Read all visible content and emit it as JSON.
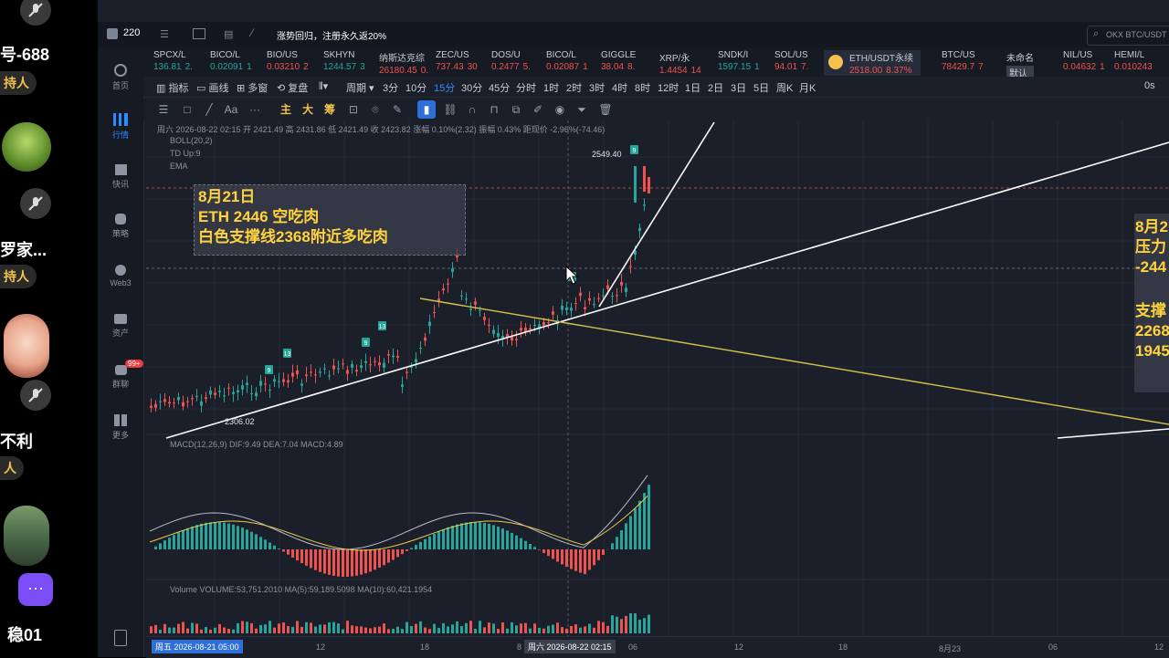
{
  "stream": {
    "names": [
      "号-688",
      "罗家...",
      "不利",
      "稳01"
    ],
    "badges": [
      "持人",
      "持人",
      "人"
    ]
  },
  "nav": {
    "items": [
      "首页",
      "行情",
      "快讯",
      "策略",
      "Web3",
      "资产",
      "群聊",
      "更多"
    ],
    "chat_badge": "99+"
  },
  "topbar": {
    "account": "220",
    "promo": "涨势回归，注册永久返20%",
    "search_placeholder": "OKX BTC/USDT"
  },
  "tickers": [
    {
      "name": "SPCX/L",
      "price": "136.81",
      "chg": "2.",
      "dir": "up"
    },
    {
      "name": "BICO/L",
      "price": "0.02091",
      "chg": "1",
      "dir": "up"
    },
    {
      "name": "BIO/US",
      "price": "0.03210",
      "chg": "2",
      "dir": "dn"
    },
    {
      "name": "SKHYN",
      "price": "1244.57",
      "chg": "3",
      "dir": "up"
    },
    {
      "name": "纳斯达克综",
      "price": "26180.45",
      "chg": "0.",
      "dir": "dn"
    },
    {
      "name": "ZEC/US",
      "price": "737.43",
      "chg": "30",
      "dir": "dn"
    },
    {
      "name": "DOS/U",
      "price": "0.2477",
      "chg": "5.",
      "dir": "dn"
    },
    {
      "name": "BICO/L",
      "price": "0.02087",
      "chg": "1",
      "dir": "dn"
    },
    {
      "name": "GIGGLE",
      "price": "38.04",
      "chg": "8.",
      "dir": "dn"
    },
    {
      "name": "XRP/永",
      "price": "1.4454",
      "chg": "14",
      "dir": "dn"
    },
    {
      "name": "SNDK/I",
      "price": "1597.15",
      "chg": "1",
      "dir": "up"
    },
    {
      "name": "SOL/US",
      "price": "94.01",
      "chg": "7.",
      "dir": "dn"
    },
    {
      "name": "ETH/USDT永续",
      "price": "2518.00",
      "chg": "8.37%",
      "dir": "dn"
    },
    {
      "name": "BTC/US",
      "price": "78429.7",
      "chg": "7",
      "dir": "dn"
    },
    {
      "name": "未命名",
      "price": "默认",
      "chg": "",
      "dir": "none"
    },
    {
      "name": "NIL/US",
      "price": "0.04632",
      "chg": "1",
      "dir": "dn"
    },
    {
      "name": "HEMI/L",
      "price": "0.010243",
      "chg": "",
      "dir": "dn"
    }
  ],
  "timeframes": {
    "left": [
      "指标",
      "画线",
      "多窗",
      "复盘"
    ],
    "period": "周期",
    "items": [
      "3分",
      "10分",
      "15分",
      "30分",
      "45分",
      "分时",
      "1时",
      "2时",
      "3时",
      "4时",
      "8时",
      "12时",
      "1日",
      "2日",
      "3日",
      "5日",
      "周K",
      "月K"
    ],
    "selected": "15分",
    "right": "0s"
  },
  "toolbar": {
    "labels": [
      "主",
      "大",
      "筹"
    ]
  },
  "chart": {
    "ohlc_line": "周六 2026-08-22 02:15  开 2421.49  高 2431.86  低 2421.49  收 2423.82  涨幅 0.10%(2.32)  振幅 0.43%  距现价 -2.96%(-74.46)",
    "indicators": [
      "BOLL(20,2)",
      "TD  Up:9",
      "EMA"
    ],
    "high_label": "2549.40",
    "low_label": "2306.02",
    "td_marks": [
      "9",
      "13",
      "9",
      "13",
      "9",
      "9"
    ],
    "annotation_left": [
      "8月21日",
      "ETH 2446 空吃肉",
      "白色支撑线2368附近多吃肉"
    ],
    "annotation_right": [
      "8月2",
      "压力",
      "-244",
      "",
      "支撑",
      "2268",
      "1945"
    ],
    "macd_line": "MACD(12,26,9)  DIF:9.49  DEA:7.04  MACD:4.89",
    "volume_line": "Volume  VOLUME:53,751.2010  MA(5):59,189.5098  MA(10):60,421.1954"
  },
  "xaxis": {
    "start_box": "周五 2026-08-21 05:00",
    "cursor_box": "周六 2026-08-22 02:15",
    "labels": [
      "12",
      "18",
      "8",
      "06",
      "12",
      "18",
      "8月23",
      "06",
      "12"
    ]
  },
  "colors": {
    "up": "#26a69a",
    "down": "#ef5350",
    "accent": "#2e8bff",
    "annotation": "#ffd33d",
    "trendline_yellow": "#d6c24a"
  }
}
